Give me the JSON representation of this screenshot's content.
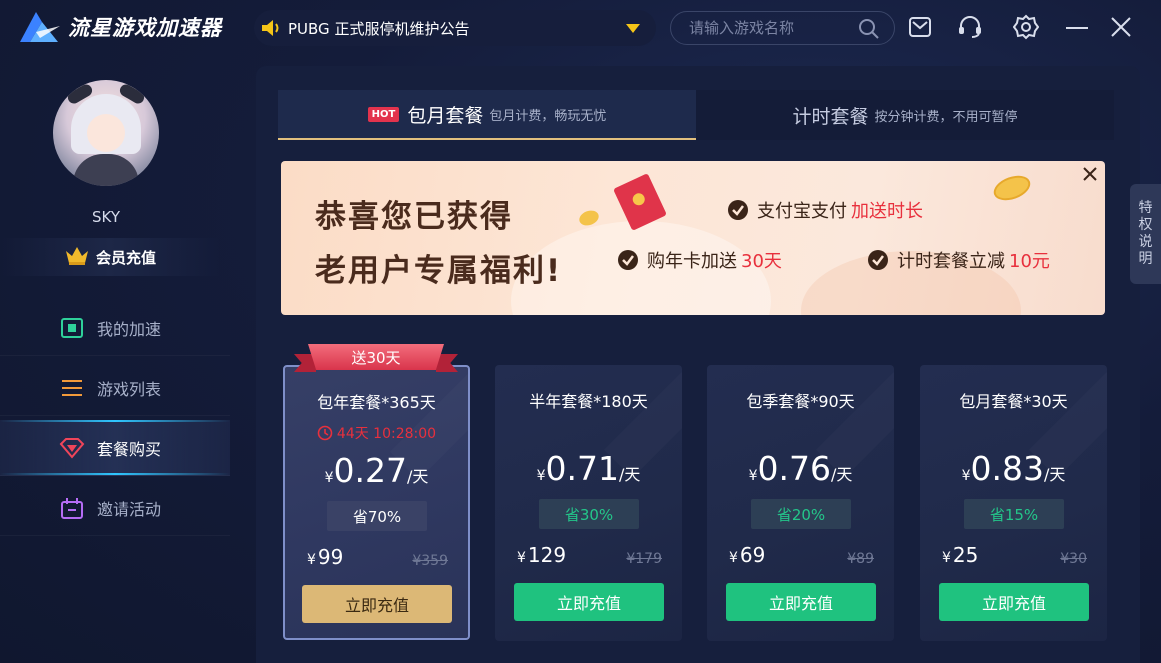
{
  "app": {
    "logo_text": "流星游戏加速器",
    "notice": "PUBG 正式服停机维护公告",
    "search_placeholder": "请输入游戏名称"
  },
  "sidebar": {
    "username": "SKY",
    "vip_label": "会员充值",
    "items": [
      {
        "label": "我的加速",
        "icon": "speed-icon"
      },
      {
        "label": "游戏列表",
        "icon": "list-icon"
      },
      {
        "label": "套餐购买",
        "icon": "diamond-icon",
        "active": true
      },
      {
        "label": "邀请活动",
        "icon": "invite-icon"
      }
    ]
  },
  "tabs": [
    {
      "badge": "HOT",
      "title": "包月套餐",
      "subtitle": "包月计费，畅玩无忧",
      "active": true
    },
    {
      "title": "计时套餐",
      "subtitle": "按分钟计费，不用可暂停"
    }
  ],
  "promo": {
    "line1": "恭喜您已获得",
    "line2": "老用户专属福利!",
    "benefits": [
      {
        "text": "支付宝支付",
        "highlight": "加送时长"
      },
      {
        "text": "购年卡加送",
        "highlight": "30天"
      },
      {
        "text": "计时套餐立减",
        "highlight": "10元"
      }
    ]
  },
  "side_tab": [
    "特",
    "权",
    "说",
    "明"
  ],
  "plans": [
    {
      "ribbon": "送30天",
      "name": "包年套餐*365天",
      "countdown": "44天  10:28:00",
      "currency": "¥",
      "daily_price": "0.27",
      "unit": "/天",
      "save": "省70%",
      "total": "99",
      "original": "¥359",
      "button": "立即充值",
      "featured": true
    },
    {
      "name": "半年套餐*180天",
      "currency": "¥",
      "daily_price": "0.71",
      "unit": "/天",
      "save": "省30%",
      "total": "129",
      "original": "¥179",
      "button": "立即充值"
    },
    {
      "name": "包季套餐*90天",
      "currency": "¥",
      "daily_price": "0.76",
      "unit": "/天",
      "save": "省20%",
      "total": "69",
      "original": "¥89",
      "button": "立即充值"
    },
    {
      "name": "包月套餐*30天",
      "currency": "¥",
      "daily_price": "0.83",
      "unit": "/天",
      "save": "省15%",
      "total": "25",
      "original": "¥30",
      "button": "立即充值"
    }
  ],
  "colors": {
    "accent_green": "#1fc27f",
    "accent_gold": "#dcb876",
    "alert_red": "#e8303d",
    "hot_badge": "#e3334d"
  }
}
